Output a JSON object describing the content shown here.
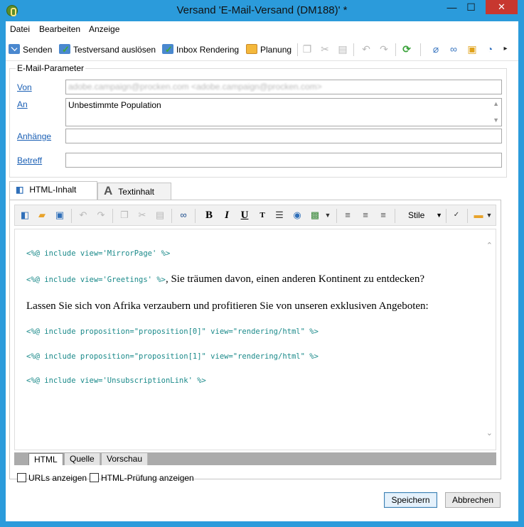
{
  "window": {
    "title": "Versand 'E-Mail-Versand (DM188)' *",
    "controls": {
      "minimize": "—",
      "maximize": "☐",
      "close": "✕"
    }
  },
  "menu": [
    "Datei",
    "Bearbeiten",
    "Anzeige"
  ],
  "toolbar": {
    "send": "Senden",
    "test_send": "Testversand auslösen",
    "inbox_rendering": "Inbox Rendering",
    "planning": "Planung",
    "overflow": "▸"
  },
  "params": {
    "legend": "E-Mail-Parameter",
    "from_label": "Von",
    "from_value": "adobe.campaign@procken.com <adobe.campaign@procken.com>",
    "to_label": "An",
    "to_value": "Unbestimmte Population",
    "attachments_label": "Anhänge",
    "attachments_value": "",
    "subject_label": "Betreff",
    "subject_value": ""
  },
  "content_tabs": {
    "html": "HTML-Inhalt",
    "text": "Textinhalt",
    "text_icon": "A"
  },
  "editor": {
    "styles_label": "Stile",
    "lines": {
      "mirror": "<%@ include view='MirrorPage' %>",
      "greet_code": "<%@ include view='Greetings' %>",
      "greet_text": ", Sie träumen davon, einen anderen Kontinent zu entdecken?",
      "africa": "Lassen Sie sich von Afrika verzaubern und profitieren Sie von unseren exklusiven Angeboten:",
      "prop0": "<%@ include proposition=\"proposition[0]\" view=\"rendering/html\" %>",
      "prop1": "<%@ include proposition=\"proposition[1]\" view=\"rendering/html\" %>",
      "unsub": "<%@ include view='UnsubscriptionLink' %>"
    }
  },
  "view_tabs": {
    "html": "HTML",
    "source": "Quelle",
    "preview": "Vorschau"
  },
  "options": {
    "show_urls": "URLs anzeigen",
    "show_html_check": "HTML-Prüfung anzeigen"
  },
  "buttons": {
    "save": "Speichern",
    "cancel": "Abbrechen"
  },
  "colors": {
    "titlebar": "#2b9bdb",
    "link": "#1a5fb4",
    "code": "#1b8a8a",
    "close": "#c7372f"
  }
}
